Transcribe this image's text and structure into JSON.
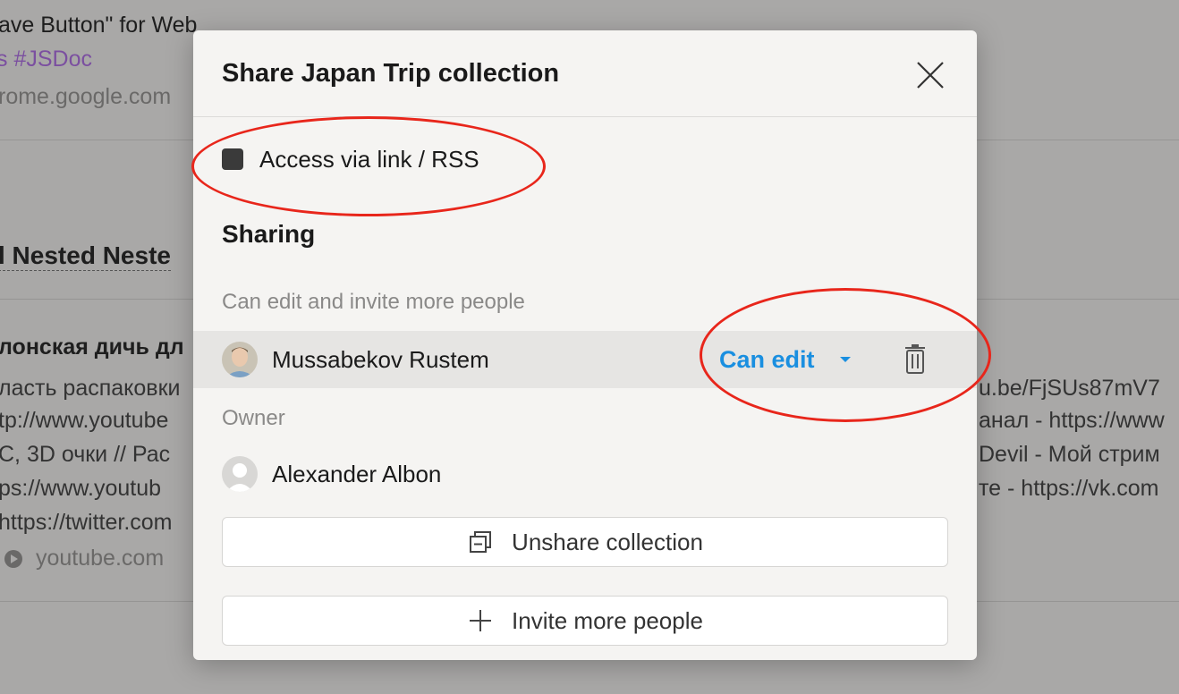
{
  "background": {
    "lines": [
      "ave Button\" for Web",
      "s  #JSDoc",
      "rome.google.com",
      "l Nested Neste",
      "лонская дичь дл",
      "ласть распаковки",
      "tp://www.youtube",
      "C, 3D очки // Рас",
      "ps://www.youtub",
      "https://twitter.com",
      "youtube.com",
      "u.be/FjSUs87mV7",
      "анал - https://www",
      "Devil - Мой стрим",
      "те - https://vk.com"
    ]
  },
  "modal": {
    "title": "Share Japan Trip collection",
    "access_checkbox": {
      "label": "Access via link / RSS",
      "checked": true
    },
    "sharing_title": "Sharing",
    "editors_label": "Can edit and invite more people",
    "editors": [
      {
        "name": "Mussabekov Rustem",
        "permission": "Can edit"
      }
    ],
    "owner_label": "Owner",
    "owner": {
      "name": "Alexander Albon"
    },
    "unshare_button": "Unshare collection",
    "invite_button": "Invite more people"
  },
  "colors": {
    "accent": "#1a8fe0",
    "annotation": "#e8261b",
    "tag": "#7b4fa0"
  },
  "icons": [
    "close-icon",
    "chevron-down-icon",
    "trash-icon",
    "unshare-icon",
    "plus-icon",
    "play-icon"
  ]
}
